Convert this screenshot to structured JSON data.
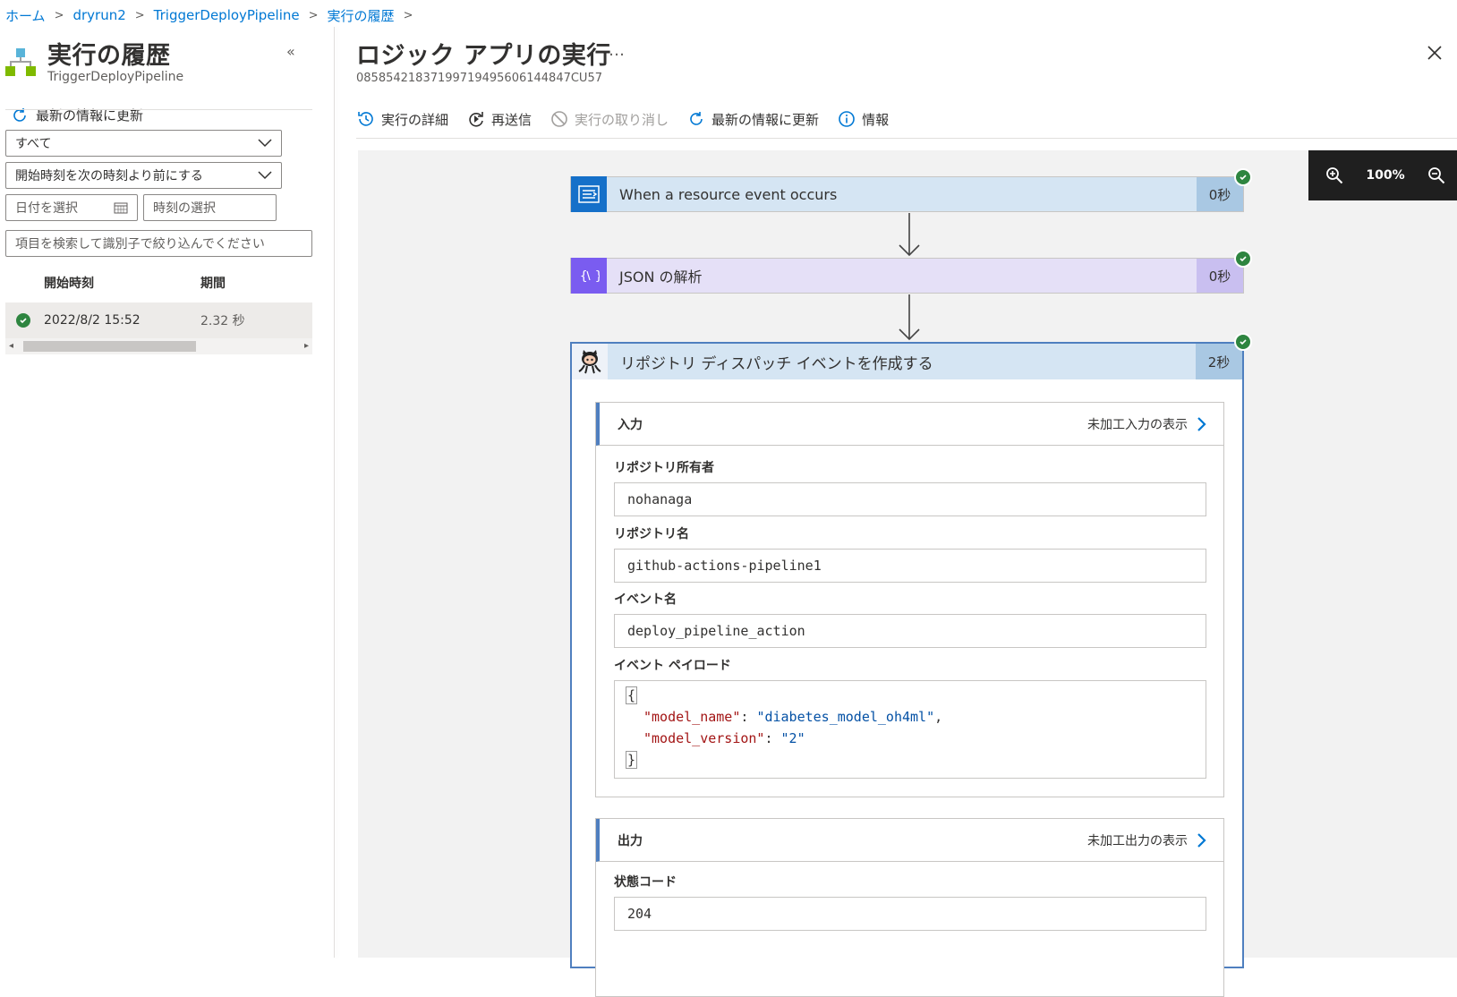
{
  "breadcrumb": [
    {
      "label": "ホーム"
    },
    {
      "label": "dryrun2"
    },
    {
      "label": "TriggerDeployPipeline"
    },
    {
      "label": "実行の履歴"
    }
  ],
  "left_panel": {
    "title": "実行の履歴",
    "subtitle": "TriggerDeployPipeline",
    "collapse_glyph": "«",
    "refresh_label": "最新の情報に更新",
    "filter_status": "すべて",
    "filter_time_mode": "開始時刻を次の時刻より前にする",
    "date_placeholder": "日付を選択",
    "time_placeholder": "時刻の選択",
    "search_placeholder": "項目を検索して識別子で絞り込んでください",
    "columns": {
      "start": "開始時刻",
      "duration": "期間"
    },
    "runs": [
      {
        "status": "succeeded",
        "start": "2022/8/2 15:52",
        "duration": "2.32 秒"
      }
    ]
  },
  "run": {
    "title": "ロジック アプリの実行",
    "more": "…",
    "run_id": "08585421837199719495606144847CU57",
    "toolbar": {
      "details": "実行の詳細",
      "resubmit": "再送信",
      "cancel": "実行の取り消し",
      "refresh": "最新の情報に更新",
      "info": "情報"
    },
    "zoom": "100%"
  },
  "workflow": {
    "trigger": {
      "label": "When a resource event occurs",
      "duration": "0秒",
      "status": "succeeded",
      "color": "#1570c9"
    },
    "parse_json": {
      "label": "JSON の解析",
      "duration": "0秒",
      "status": "succeeded",
      "color": "#7a5cf0"
    },
    "dispatch": {
      "label": "リポジトリ ディスパッチ イベントを作成する",
      "duration": "2秒",
      "status": "succeeded",
      "inputs": {
        "section_title": "入力",
        "raw_link": "未加工入力の表示",
        "owner_label": "リポジトリ所有者",
        "owner": "nohanaga",
        "repo_label": "リポジトリ名",
        "repo": "github-actions-pipeline1",
        "event_label": "イベント名",
        "event": "deploy_pipeline_action",
        "payload_label": "イベント ペイロード",
        "payload": {
          "open": "{",
          "k1": "\"model_name\"",
          "v1": "\"diabetes_model_oh4ml\"",
          "k2": "\"model_version\"",
          "v2": "\"2\"",
          "close": "}"
        }
      },
      "outputs": {
        "section_title": "出力",
        "raw_link": "未加工出力の表示",
        "status_label": "状態コード",
        "status_code": "204"
      }
    }
  },
  "colors": {
    "accent": "#0078d4",
    "success": "#2e8540"
  }
}
